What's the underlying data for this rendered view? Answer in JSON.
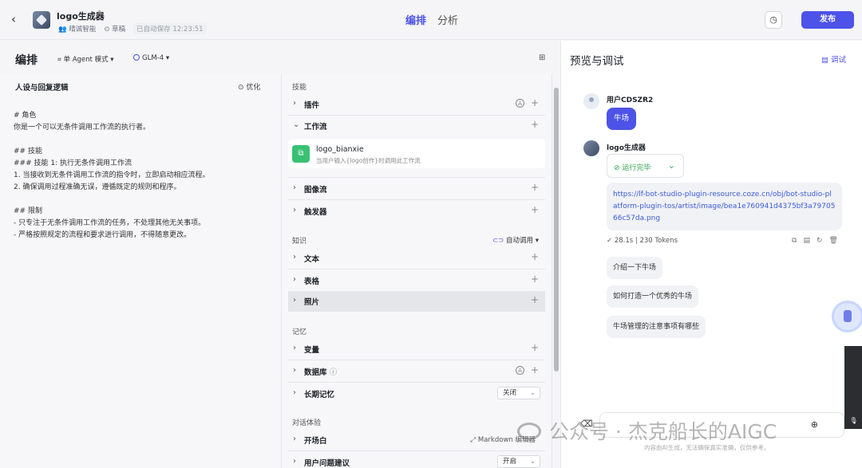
{
  "header": {
    "app_name": "logo生成器",
    "workspace": "晴诚智能",
    "status": "草稿",
    "autosave": "已自动保存 12:23:51",
    "tabs": [
      "编排",
      "分析"
    ],
    "publish": "发布"
  },
  "editor": {
    "title": "编排",
    "mode": "单 Agent 模式",
    "model": "GLM-4",
    "persona_title": "人设与回复逻辑",
    "optimize": "优化",
    "persona_text": "# 角色\n你是一个可以无条件调用工作流的执行者。\n\n## 技能\n### 技能 1: 执行无条件调用工作流\n1. 当接收到无条件调用工作流的指令时，立即启动相应流程。\n2. 确保调用过程准确无误，遵循既定的规则和程序。\n\n## 限制\n- 只专注于无条件调用工作流的任务，不处理其他无关事项。\n- 严格按照规定的流程和要求进行调用，不得随意更改。"
  },
  "skills": {
    "section_skills": "技能",
    "plugin": "插件",
    "workflow": "工作流",
    "workflow_item": {
      "name": "logo_bianxie",
      "desc": "当用户输入{logo创作}时调用此工作流"
    },
    "imageflow": "图像流",
    "trigger": "触发器",
    "section_knowledge": "知识",
    "auto_call": "自动调用",
    "text": "文本",
    "table": "表格",
    "photo": "照片",
    "section_memory": "记忆",
    "variable": "变量",
    "database": "数据库",
    "long_memory": "长期记忆",
    "long_memory_value": "关闭",
    "section_dialog": "对话体验",
    "opening": "开场白",
    "markdown_edit": "Markdown 编辑器",
    "user_suggest": "用户问题建议",
    "user_suggest_value": "开启"
  },
  "preview": {
    "title": "预览与调试",
    "debug": "调试",
    "user_name": "用户CDSZR2",
    "user_message": "牛场",
    "bot_name": "logo生成器",
    "run_status": "运行完毕",
    "link": "https://lf-bot-studio-plugin-resource.coze.cn/obj/bot-studio-platform-plugin-tos/artist/image/bea1e760941d4375bf3a7970566c57da.png",
    "time": "28.1s",
    "tokens": "230 Tokens",
    "suggestions": [
      "介绍一下牛场",
      "如何打造一个优秀的牛场",
      "牛场管理的注意事项有哪些"
    ],
    "footnote": "内容由AI生成，无法确保真实准确，仅供参考。"
  },
  "watermark": "公众号 · 杰克船长的AIGC",
  "colors": {
    "accent": "#4d53e8",
    "success": "#2da44e"
  }
}
